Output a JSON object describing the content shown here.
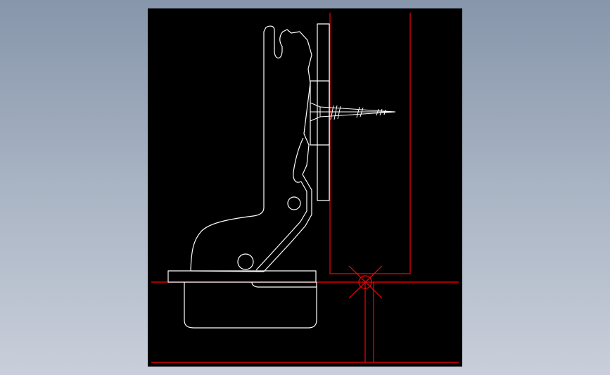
{
  "viewer": {
    "background": "#8796ab",
    "canvas_color": "#000000"
  },
  "drawing": {
    "part_color": "#ffffff",
    "cabinet_color": "#ff0000",
    "screw_color": "#ffffff"
  }
}
